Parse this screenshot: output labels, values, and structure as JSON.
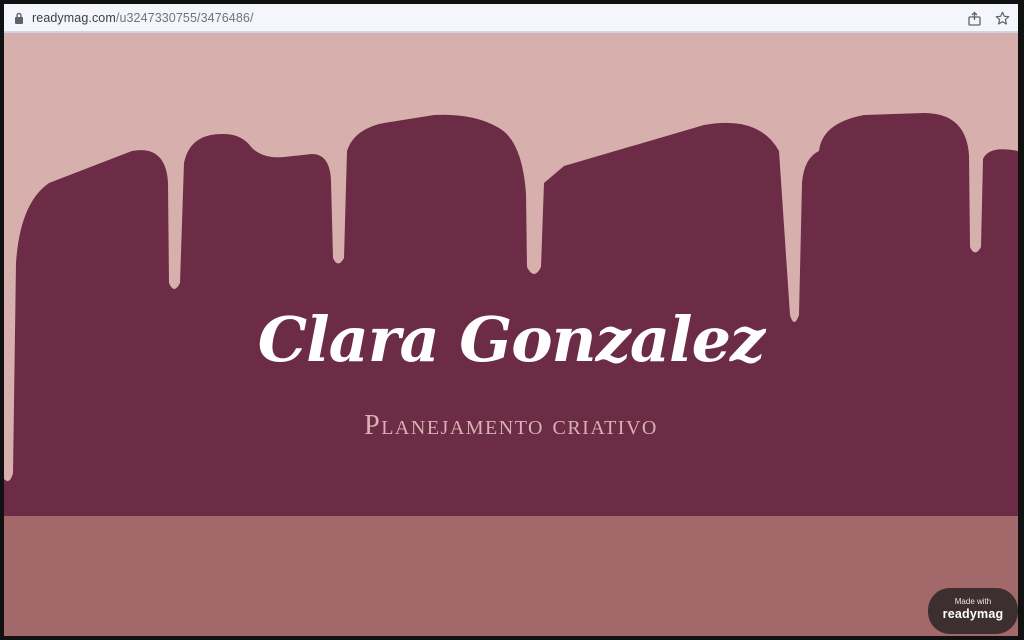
{
  "browser": {
    "url_domain": "readymag.com",
    "url_path": "/u3247330755/3476486/",
    "icons": [
      "lock-icon",
      "share-icon",
      "bookmark-star-icon"
    ]
  },
  "hero": {
    "title": "Clara Gonzalez",
    "subtitle": "Planejamento criativo"
  },
  "badge": {
    "small_text": "Made with",
    "brand_text": "readymag"
  },
  "colors": {
    "background_pink": "#d7b0ae",
    "drip_maroon": "#6c2c46",
    "footer_rose": "#a3686a",
    "subtitle_pink": "#d9b1b1",
    "badge_dark": "#3d2f2f"
  }
}
